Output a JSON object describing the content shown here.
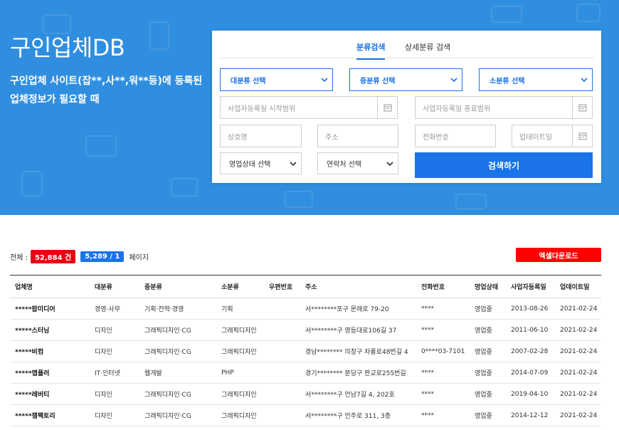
{
  "hero": {
    "title": "구인업체DB",
    "desc_line1": "구인업체 사이트(잡**,사**,워**등)에 등록된",
    "desc_line2": "업체정보가 필요할 때"
  },
  "search": {
    "tabs": [
      {
        "label": "분류검색",
        "active": true
      },
      {
        "label": "상세분류 검색",
        "active": false
      }
    ],
    "major_select": "대분류 선택",
    "middle_select": "중분류 선택",
    "minor_select": "소분류 선택",
    "reg_start_placeholder": "사업자등록일 시작범위",
    "reg_end_placeholder": "사업자등록일 종료범위",
    "company_placeholder": "상호명",
    "address_placeholder": "주소",
    "phone_placeholder": "전화번호",
    "update_placeholder": "업데이트일",
    "status_select": "영업상태 선택",
    "contact_select": "연락처 선택",
    "search_button": "검색하기"
  },
  "summary": {
    "total_label": "전체 :",
    "total_count": "52,884 건",
    "pages": "5,289 / 1",
    "page_label": "페이지",
    "excel_button": "엑셀다운로드"
  },
  "table": {
    "headers": [
      "업체명",
      "대분류",
      "중분류",
      "소분류",
      "우편번호",
      "주소",
      "전화번호",
      "영업상태",
      "사업자등록일",
      "업데이트일"
    ],
    "rows": [
      [
        "*****팝미디어",
        "경영·사무",
        "기획·전략·경영",
        "기획",
        "",
        "서********포구 문래로 79-20",
        "****",
        "영업중",
        "2013-08-26",
        "2021-02-24"
      ],
      [
        "*****스터닝",
        "디자인",
        "그래픽디자인·CG",
        "그래픽디자인",
        "",
        "서********구 영등대로106길 37",
        "****",
        "영업중",
        "2011-06-10",
        "2021-02-24"
      ],
      [
        "*****비컴",
        "디자인",
        "그래픽디자인·CG",
        "그래픽디자인",
        "",
        "경남******** 의창구 차룡로48번길 4",
        "0****03-7101",
        "영업중",
        "2007-02-28",
        "2021-02-24"
      ],
      [
        "*****앱플러",
        "IT·인터넷",
        "웹개발",
        "PHP",
        "",
        "경기******** 분당구 판교로255번길",
        "****",
        "영업중",
        "2014-07-09",
        "2021-02-24"
      ],
      [
        "*****레버티",
        "디자인",
        "그래픽디자인·CG",
        "그래픽디자인",
        "",
        "서********구 언남7길 4, 202호",
        "****",
        "영업중",
        "2019-04-10",
        "2021-02-24"
      ],
      [
        "*****잼팩토리",
        "디자인",
        "그래픽디자인·CG",
        "그래픽디자인",
        "",
        "서********구 언주로 311, 3층",
        "****",
        "영업중",
        "2014-12-12",
        "2021-02-24"
      ]
    ]
  },
  "colors": {
    "hero_bg": "#2f8ee0",
    "accent": "#1a73e8",
    "badge_red": "#e60012",
    "excel_red": "#ff0000"
  }
}
